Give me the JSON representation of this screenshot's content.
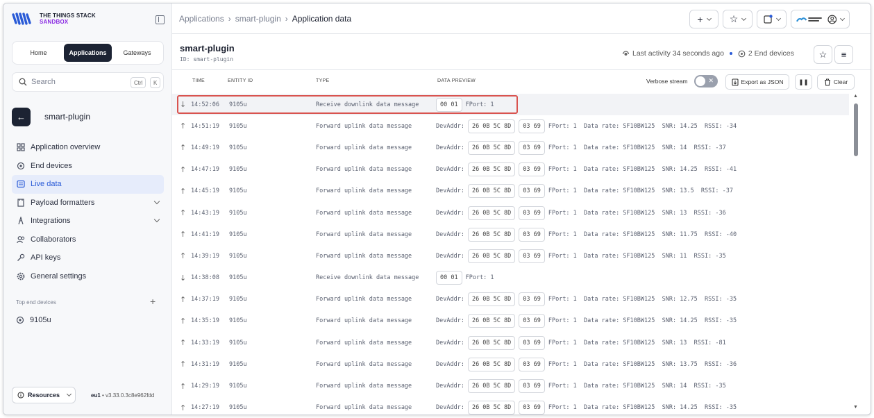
{
  "brand": {
    "line1": "THE THINGS STACK",
    "line2": "SANDBOX"
  },
  "seg_tabs": [
    "Home",
    "Applications",
    "Gateways"
  ],
  "search": {
    "label": "Search",
    "kbd1": "Ctrl",
    "kbd2": "K"
  },
  "sidebar": {
    "app_name": "smart-plugin",
    "items": [
      {
        "label": "Application overview"
      },
      {
        "label": "End devices"
      },
      {
        "label": "Live data"
      },
      {
        "label": "Payload formatters"
      },
      {
        "label": "Integrations"
      },
      {
        "label": "Collaborators"
      },
      {
        "label": "API keys"
      },
      {
        "label": "General settings"
      }
    ],
    "section_label": "Top end devices",
    "device": "9105u",
    "resources": "Resources",
    "region": "eu1",
    "version": "v3.33.0.3c8e962fdd"
  },
  "breadcrumb": {
    "c1": "Applications",
    "c2": "smart-plugin",
    "c3": "Application data"
  },
  "header": {
    "title": "smart-plugin",
    "id": "ID: smart-plugin",
    "activity": "Last activity 34 seconds ago",
    "end_devices": "2 End devices"
  },
  "toolbar": {
    "col_time": "TIME",
    "col_entity": "ENTITY ID",
    "col_type": "TYPE",
    "col_preview": "DATA PREVIEW",
    "verbose": "Verbose stream",
    "export": "Export as JSON",
    "clear": "Clear"
  },
  "events": [
    {
      "dir": "down",
      "time": "14:52:06",
      "eid": "9105u",
      "type": "Receive downlink data message",
      "payload": "00 01",
      "rest": "FPort: 1"
    },
    {
      "dir": "up",
      "time": "14:51:19",
      "eid": "9105u",
      "type": "Forward uplink data message",
      "addr_label": "DevAddr:",
      "addr": "26 0B 5C 8D",
      "payload": "03 69",
      "rest": "FPort: 1  Data rate: SF10BW125  SNR: 14.25  RSSI: -34"
    },
    {
      "dir": "up",
      "time": "14:49:19",
      "eid": "9105u",
      "type": "Forward uplink data message",
      "addr_label": "DevAddr:",
      "addr": "26 0B 5C 8D",
      "payload": "03 69",
      "rest": "FPort: 1  Data rate: SF10BW125  SNR: 14  RSSI: -37"
    },
    {
      "dir": "up",
      "time": "14:47:19",
      "eid": "9105u",
      "type": "Forward uplink data message",
      "addr_label": "DevAddr:",
      "addr": "26 0B 5C 8D",
      "payload": "03 69",
      "rest": "FPort: 1  Data rate: SF10BW125  SNR: 14.25  RSSI: -41"
    },
    {
      "dir": "up",
      "time": "14:45:19",
      "eid": "9105u",
      "type": "Forward uplink data message",
      "addr_label": "DevAddr:",
      "addr": "26 0B 5C 8D",
      "payload": "03 69",
      "rest": "FPort: 1  Data rate: SF10BW125  SNR: 13.5  RSSI: -37"
    },
    {
      "dir": "up",
      "time": "14:43:19",
      "eid": "9105u",
      "type": "Forward uplink data message",
      "addr_label": "DevAddr:",
      "addr": "26 0B 5C 8D",
      "payload": "03 69",
      "rest": "FPort: 1  Data rate: SF10BW125  SNR: 13  RSSI: -36"
    },
    {
      "dir": "up",
      "time": "14:41:19",
      "eid": "9105u",
      "type": "Forward uplink data message",
      "addr_label": "DevAddr:",
      "addr": "26 0B 5C 8D",
      "payload": "03 69",
      "rest": "FPort: 1  Data rate: SF10BW125  SNR: 11.75  RSSI: -40"
    },
    {
      "dir": "up",
      "time": "14:39:19",
      "eid": "9105u",
      "type": "Forward uplink data message",
      "addr_label": "DevAddr:",
      "addr": "26 0B 5C 8D",
      "payload": "03 69",
      "rest": "FPort: 1  Data rate: SF10BW125  SNR: 11  RSSI: -35"
    },
    {
      "dir": "down",
      "time": "14:38:08",
      "eid": "9105u",
      "type": "Receive downlink data message",
      "payload": "00 01",
      "rest": "FPort: 1"
    },
    {
      "dir": "up",
      "time": "14:37:19",
      "eid": "9105u",
      "type": "Forward uplink data message",
      "addr_label": "DevAddr:",
      "addr": "26 0B 5C 8D",
      "payload": "03 69",
      "rest": "FPort: 1  Data rate: SF10BW125  SNR: 12.75  RSSI: -35"
    },
    {
      "dir": "up",
      "time": "14:35:19",
      "eid": "9105u",
      "type": "Forward uplink data message",
      "addr_label": "DevAddr:",
      "addr": "26 0B 5C 8D",
      "payload": "03 69",
      "rest": "FPort: 1  Data rate: SF10BW125  SNR: 14.25  RSSI: -35"
    },
    {
      "dir": "up",
      "time": "14:33:19",
      "eid": "9105u",
      "type": "Forward uplink data message",
      "addr_label": "DevAddr:",
      "addr": "26 0B 5C 8D",
      "payload": "03 69",
      "rest": "FPort: 1  Data rate: SF10BW125  SNR: 13  RSSI: -81"
    },
    {
      "dir": "up",
      "time": "14:31:19",
      "eid": "9105u",
      "type": "Forward uplink data message",
      "addr_label": "DevAddr:",
      "addr": "26 0B 5C 8D",
      "payload": "03 69",
      "rest": "FPort: 1  Data rate: SF10BW125  SNR: 13.75  RSSI: -36"
    },
    {
      "dir": "up",
      "time": "14:29:19",
      "eid": "9105u",
      "type": "Forward uplink data message",
      "addr_label": "DevAddr:",
      "addr": "26 0B 5C 8D",
      "payload": "03 69",
      "rest": "FPort: 1  Data rate: SF10BW125  SNR: 14  RSSI: -35"
    },
    {
      "dir": "up",
      "time": "14:27:19",
      "eid": "9105u",
      "type": "Forward uplink data message",
      "addr_label": "DevAddr:",
      "addr": "26 0B 5C 8D",
      "payload": "03 69",
      "rest": "FPort: 1  Data rate: SF10BW125  SNR: 14.25  RSSI: -35"
    }
  ],
  "colors": {
    "accent": "#2a5bd7",
    "dark": "#1c2333",
    "highlight_border": "#d9534f",
    "brand_purple": "#8a2be2"
  }
}
